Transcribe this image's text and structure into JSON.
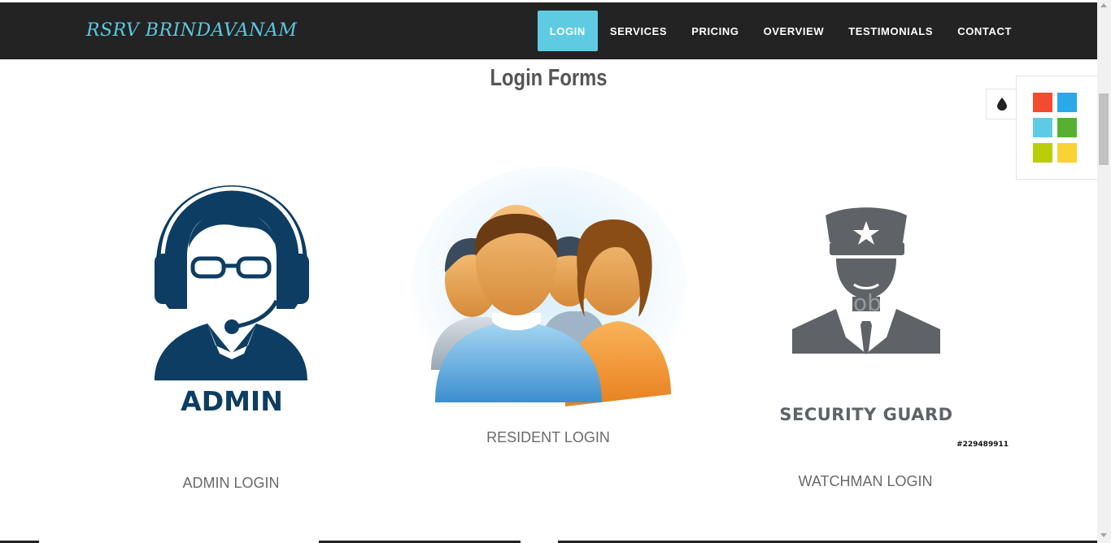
{
  "brand": "RSRV BRINDAVANAM",
  "nav": {
    "items": [
      {
        "label": "LOGIN",
        "active": true
      },
      {
        "label": "SERVICES"
      },
      {
        "label": "PRICING"
      },
      {
        "label": "OVERVIEW"
      },
      {
        "label": "TESTIMONIALS"
      },
      {
        "label": "CONTACT"
      }
    ]
  },
  "heading": "Login Forms",
  "cards": {
    "admin": {
      "image_text": "ADMIN",
      "label": "ADMIN LOGIN"
    },
    "resident": {
      "label": "RESIDENT LOGIN"
    },
    "watchman": {
      "image_text": "SECURITY GUARD",
      "image_id": "#229489911",
      "watermark": "Adobe Stock",
      "label": "WATCHMAN LOGIN"
    }
  },
  "color_switcher": {
    "icon": "drop-icon",
    "colors": [
      "#f44a2f",
      "#29a9e6",
      "#5fcbe3",
      "#58b032",
      "#b9cd09",
      "#fad234"
    ]
  }
}
